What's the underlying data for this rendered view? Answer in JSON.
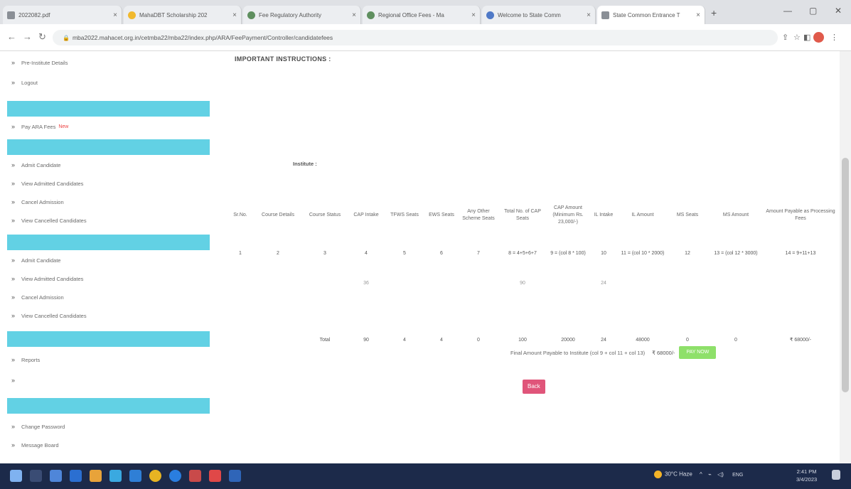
{
  "browser": {
    "tabs": [
      {
        "title": "2022082.pdf",
        "icon": "document-icon"
      },
      {
        "title": "MahaDBT Scholarship 202",
        "icon": "scholarship-icon"
      },
      {
        "title": "Fee Regulatory Authority",
        "icon": "globe-icon"
      },
      {
        "title": "Regional Office Fees - Ma",
        "icon": "globe-icon"
      },
      {
        "title": "Welcome to State Comm",
        "icon": "globe-icon"
      },
      {
        "title": "State Common Entrance T",
        "icon": "document-icon"
      }
    ],
    "url": "mba2022.mahacet.org.in/cetmba22/mba22/index.php/ARA/FeePayment/Controller/candidatefees"
  },
  "sidebar": {
    "top_items": [
      {
        "label": "Pre-Institute Details"
      },
      {
        "label": "Logout"
      }
    ],
    "sections": [
      {
        "header": "",
        "items": [
          {
            "label": "Pay ARA Fees",
            "tag": "New"
          }
        ]
      },
      {
        "header": "",
        "items": [
          {
            "label": "Admit Candidate"
          },
          {
            "label": "View Admitted Candidates"
          },
          {
            "label": "Cancel Admission"
          },
          {
            "label": "View Cancelled Candidates"
          }
        ]
      },
      {
        "header": "",
        "items": [
          {
            "label": "Admit Candidate"
          },
          {
            "label": "View Admitted Candidates"
          },
          {
            "label": "Cancel Admission"
          },
          {
            "label": "View Cancelled Candidates"
          }
        ]
      },
      {
        "header": "",
        "items": [
          {
            "label": "Reports"
          },
          {
            "label": ""
          }
        ]
      },
      {
        "header": "",
        "items": [
          {
            "label": "Change Password"
          },
          {
            "label": "Message Board"
          }
        ]
      }
    ]
  },
  "main": {
    "instructions_title": "IMPORTANT INSTRUCTIONS :",
    "instructions": [
      "",
      "",
      "",
      "",
      "",
      "",
      ""
    ],
    "institute_label": "Institute :",
    "institute_value": "",
    "table": {
      "headers": [
        "Sr.No.",
        "Course Details",
        "Course Status",
        "CAP Intake",
        "TFWS Seats",
        "EWS Seats",
        "Any Other Scheme Seats",
        "Total No. of CAP Seats",
        "CAP Amount (Minimum Rs. 23,000/-)",
        "IL Intake",
        "IL Amount",
        "MS Seats",
        "MS Amount",
        "Amount Payable as Processing Fees"
      ],
      "index_row": [
        "1",
        "2",
        "3",
        "4",
        "5",
        "6",
        "7",
        "8 = 4+5+6+7",
        "9 = (col 8 * 100)",
        "10",
        "11 = (col 10 * 2000)",
        "12",
        "13 = (col 12 * 3000)",
        "14 = 9+11+13"
      ],
      "rows": [
        [
          "",
          "",
          "",
          "36",
          "",
          "",
          "",
          "90",
          "",
          "24",
          "",
          "",
          "",
          ""
        ],
        [
          "",
          "",
          "",
          "",
          "",
          "",
          "",
          "",
          "",
          "",
          "",
          "",
          "",
          ""
        ]
      ],
      "total_row": [
        "",
        "",
        "Total",
        "90",
        "4",
        "4",
        "0",
        "100",
        "20000",
        "24",
        "48000",
        "0",
        "0",
        "₹ 68000/-"
      ]
    },
    "final_label": "Final Amount Payable to Institute (col 9 + col 11 + col 13)",
    "final_amount": "₹ 68000/-",
    "pay_button": "PAY NOW",
    "back_button": "Back"
  },
  "taskbar": {
    "weather": "30°C Haze",
    "lang": "ENG",
    "region": "IN",
    "time": "2:41 PM",
    "date": "3/4/2023"
  }
}
